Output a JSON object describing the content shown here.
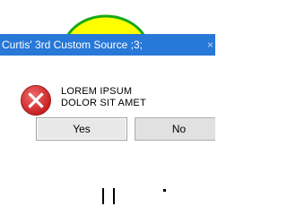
{
  "dialog": {
    "title": "Curtis' 3rd Custom Source ;3;",
    "close_glyph": "×",
    "icon": "error-icon",
    "message_line1": "LOREM IPSUM",
    "message_line2": "DOLOR SIT AMET",
    "buttons": {
      "yes_label": "Yes",
      "no_label": "No"
    }
  },
  "colors": {
    "titlebar": "#2878d8",
    "error_red": "#d92b2b",
    "doodle_yellow": "#ffff00",
    "doodle_green": "#18a818"
  }
}
